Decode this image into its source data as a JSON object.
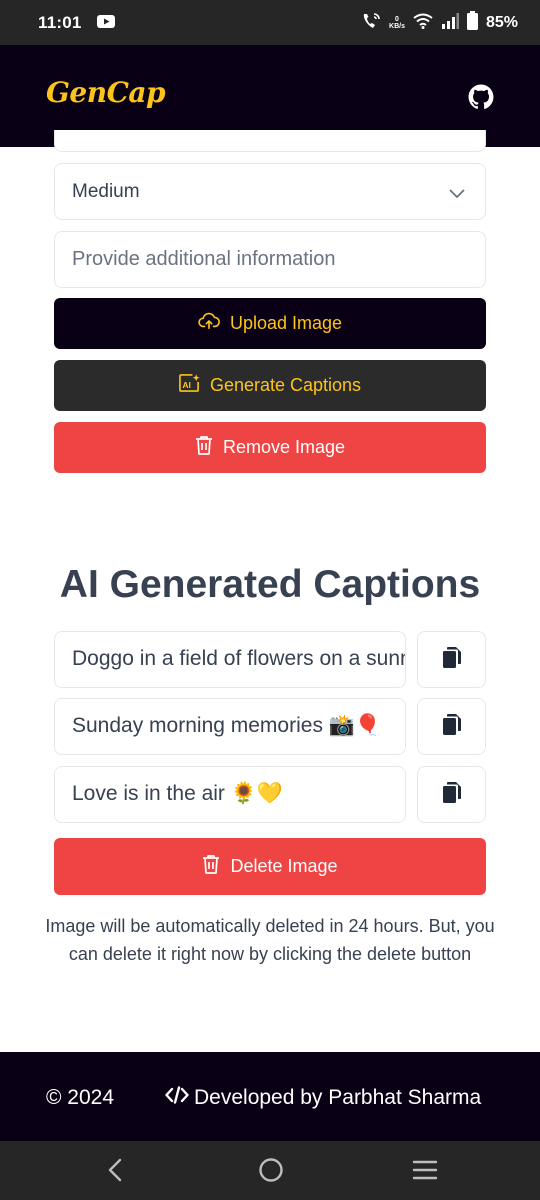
{
  "status_bar": {
    "time": "11:01",
    "net_speed_value": "0",
    "net_speed_unit": "KB/s",
    "battery": "85%"
  },
  "header": {
    "logo": "GenCap",
    "github_icon": "github-icon"
  },
  "form": {
    "length_select": {
      "value": "Medium"
    },
    "info_input": {
      "value": "",
      "placeholder": "Provide additional information"
    },
    "upload_label": "Upload Image",
    "generate_label": "Generate Captions",
    "remove_label": "Remove Image"
  },
  "captions_section": {
    "title": "AI Generated Captions",
    "captions": [
      {
        "text": "Doggo in a field of flowers on a sunny day"
      },
      {
        "text": "Sunday morning memories 📸🎈"
      },
      {
        "text": "Love is in the air 🌻💛"
      }
    ],
    "delete_label": "Delete Image",
    "note": "Image will be automatically deleted in 24 hours. But, you can delete it right now by clicking the delete button"
  },
  "footer": {
    "copyright": "© 2024",
    "developer": "Developed by Parbhat Sharma"
  },
  "colors": {
    "dark": "#0a0016",
    "accent": "#fcc419",
    "danger": "#ef4444",
    "text": "#374151"
  }
}
